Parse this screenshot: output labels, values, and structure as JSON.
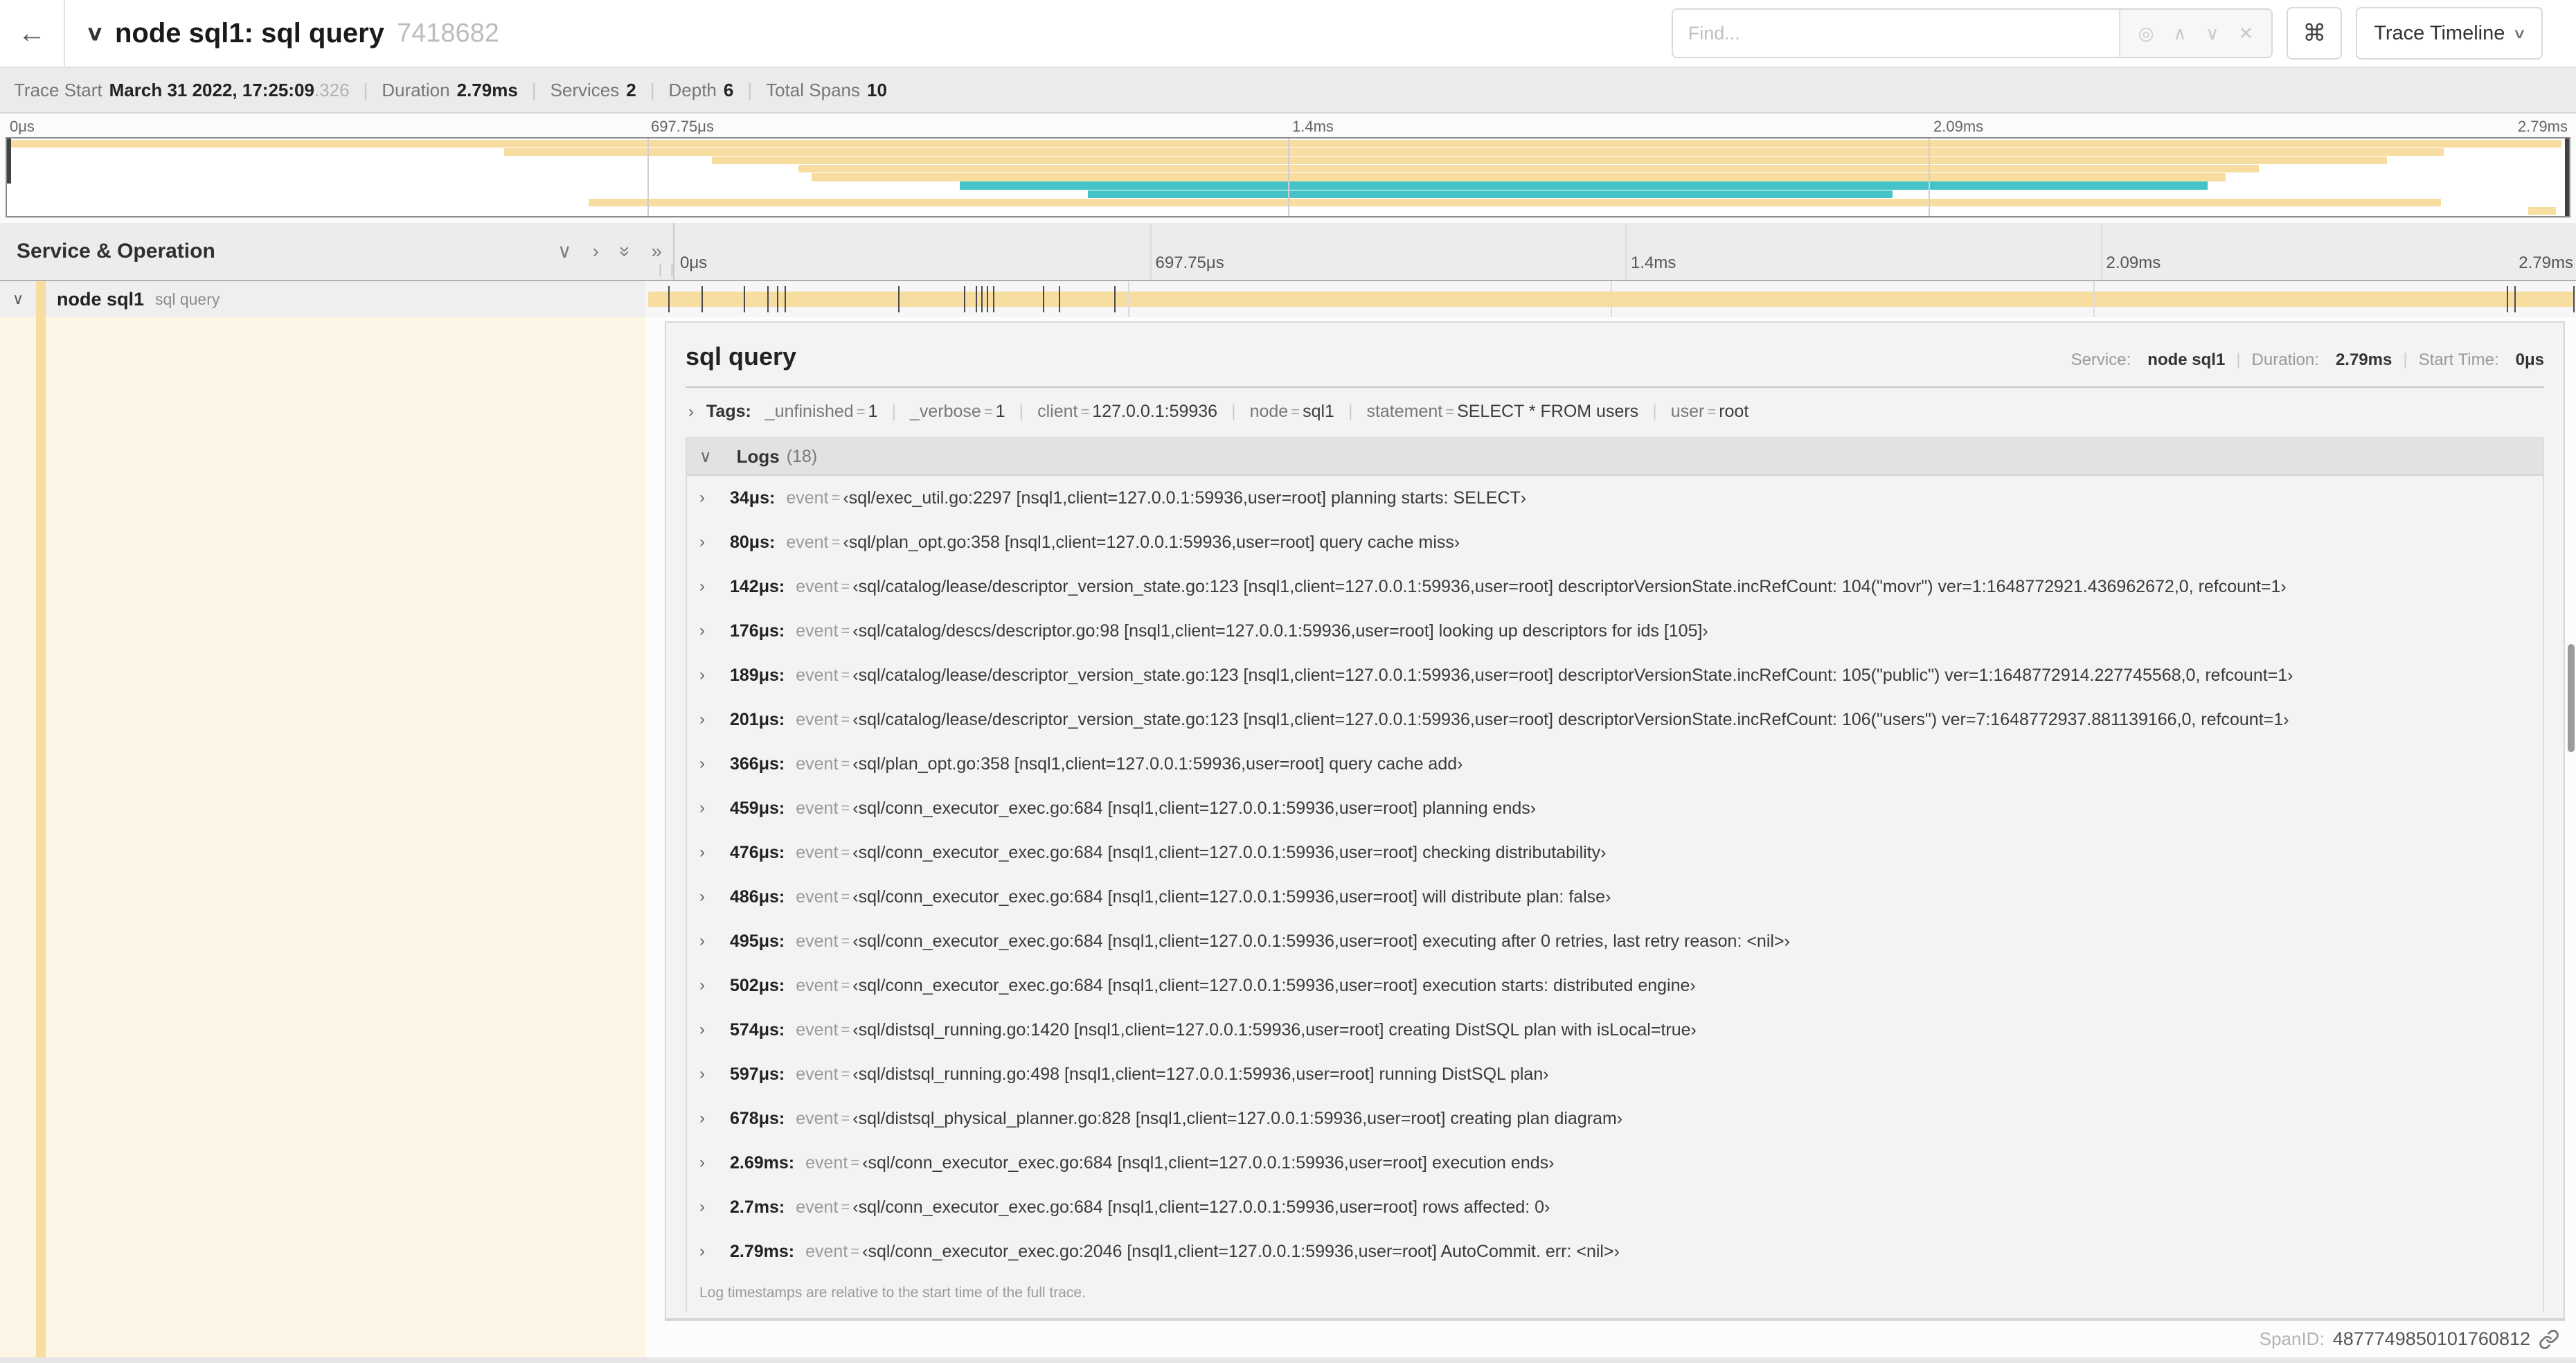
{
  "header": {
    "back_icon": "←",
    "title": "node sql1: sql query",
    "trace_id": "7418682",
    "find_placeholder": "Find...",
    "kbd_icon": "⌘",
    "view_select": "Trace Timeline"
  },
  "trace_info": {
    "items": [
      {
        "label": "Trace Start",
        "value": "March 31 2022, 17:25:09",
        "suffix": ".326"
      },
      {
        "label": "Duration",
        "value": "2.79ms"
      },
      {
        "label": "Services",
        "value": "2"
      },
      {
        "label": "Depth",
        "value": "6"
      },
      {
        "label": "Total Spans",
        "value": "10"
      }
    ]
  },
  "timeline": {
    "column_header": "Service & Operation",
    "ticks": [
      "0μs",
      "697.75μs",
      "1.4ms",
      "2.09ms",
      "2.79ms"
    ]
  },
  "minimap": {
    "spans": [
      {
        "start": 0,
        "end": 99.7,
        "color": "tan"
      },
      {
        "start": 19.4,
        "end": 95.1,
        "color": "tan"
      },
      {
        "start": 27.5,
        "end": 92.9,
        "color": "tan"
      },
      {
        "start": 30.9,
        "end": 87.9,
        "color": "tan"
      },
      {
        "start": 31.4,
        "end": 86.6,
        "color": "tan"
      },
      {
        "start": 37.2,
        "end": 85.9,
        "color": "teal"
      },
      {
        "start": 42.2,
        "end": 73.6,
        "color": "teal"
      },
      {
        "start": 22.7,
        "end": 95.0,
        "color": "tan"
      },
      {
        "start": 98.4,
        "end": 99.5,
        "color": "tan"
      }
    ]
  },
  "span_row": {
    "service": "node sql1",
    "operation": "sql query",
    "log_marks_pct": [
      1.2,
      2.9,
      5.1,
      6.3,
      6.8,
      7.2,
      13.1,
      16.5,
      17.1,
      17.4,
      17.7,
      18.0,
      20.6,
      21.4,
      24.3,
      96.4,
      96.8,
      99.85
    ]
  },
  "detail": {
    "operation": "sql query",
    "meta": [
      {
        "label": "Service:",
        "value": "node sql1"
      },
      {
        "label": "Duration:",
        "value": "2.79ms"
      },
      {
        "label": "Start Time:",
        "value": "0μs"
      }
    ],
    "tags_label": "Tags:",
    "tags": [
      {
        "key": "_unfinished",
        "value": "1"
      },
      {
        "key": "_verbose",
        "value": "1"
      },
      {
        "key": "client",
        "value": "127.0.0.1:59936"
      },
      {
        "key": "node",
        "value": "sql1"
      },
      {
        "key": "statement",
        "value": "SELECT * FROM users"
      },
      {
        "key": "user",
        "value": "root"
      }
    ],
    "logs_label": "Logs",
    "logs_count": "(18)",
    "logs": [
      {
        "ts": "34μs:",
        "key": "event",
        "value": "‹sql/exec_util.go:2297 [nsql1,client=127.0.0.1:59936,user=root] planning starts: SELECT›"
      },
      {
        "ts": "80μs:",
        "key": "event",
        "value": "‹sql/plan_opt.go:358 [nsql1,client=127.0.0.1:59936,user=root] query cache miss›"
      },
      {
        "ts": "142μs:",
        "key": "event",
        "value": "‹sql/catalog/lease/descriptor_version_state.go:123 [nsql1,client=127.0.0.1:59936,user=root] descriptorVersionState.incRefCount: 104(\"movr\") ver=1:1648772921.436962672,0, refcount=1›"
      },
      {
        "ts": "176μs:",
        "key": "event",
        "value": "‹sql/catalog/descs/descriptor.go:98 [nsql1,client=127.0.0.1:59936,user=root] looking up descriptors for ids [105]›"
      },
      {
        "ts": "189μs:",
        "key": "event",
        "value": "‹sql/catalog/lease/descriptor_version_state.go:123 [nsql1,client=127.0.0.1:59936,user=root] descriptorVersionState.incRefCount: 105(\"public\") ver=1:1648772914.227745568,0, refcount=1›"
      },
      {
        "ts": "201μs:",
        "key": "event",
        "value": "‹sql/catalog/lease/descriptor_version_state.go:123 [nsql1,client=127.0.0.1:59936,user=root] descriptorVersionState.incRefCount: 106(\"users\") ver=7:1648772937.881139166,0, refcount=1›"
      },
      {
        "ts": "366μs:",
        "key": "event",
        "value": "‹sql/plan_opt.go:358 [nsql1,client=127.0.0.1:59936,user=root] query cache add›"
      },
      {
        "ts": "459μs:",
        "key": "event",
        "value": "‹sql/conn_executor_exec.go:684 [nsql1,client=127.0.0.1:59936,user=root] planning ends›"
      },
      {
        "ts": "476μs:",
        "key": "event",
        "value": "‹sql/conn_executor_exec.go:684 [nsql1,client=127.0.0.1:59936,user=root] checking distributability›"
      },
      {
        "ts": "486μs:",
        "key": "event",
        "value": "‹sql/conn_executor_exec.go:684 [nsql1,client=127.0.0.1:59936,user=root] will distribute plan: false›"
      },
      {
        "ts": "495μs:",
        "key": "event",
        "value": "‹sql/conn_executor_exec.go:684 [nsql1,client=127.0.0.1:59936,user=root] executing after 0 retries, last retry reason: <nil>›"
      },
      {
        "ts": "502μs:",
        "key": "event",
        "value": "‹sql/conn_executor_exec.go:684 [nsql1,client=127.0.0.1:59936,user=root] execution starts: distributed engine›"
      },
      {
        "ts": "574μs:",
        "key": "event",
        "value": "‹sql/distsql_running.go:1420 [nsql1,client=127.0.0.1:59936,user=root] creating DistSQL plan with isLocal=true›"
      },
      {
        "ts": "597μs:",
        "key": "event",
        "value": "‹sql/distsql_running.go:498 [nsql1,client=127.0.0.1:59936,user=root] running DistSQL plan›"
      },
      {
        "ts": "678μs:",
        "key": "event",
        "value": "‹sql/distsql_physical_planner.go:828 [nsql1,client=127.0.0.1:59936,user=root] creating plan diagram›"
      },
      {
        "ts": "2.69ms:",
        "key": "event",
        "value": "‹sql/conn_executor_exec.go:684 [nsql1,client=127.0.0.1:59936,user=root] execution ends›"
      },
      {
        "ts": "2.7ms:",
        "key": "event",
        "value": "‹sql/conn_executor_exec.go:684 [nsql1,client=127.0.0.1:59936,user=root] rows affected: 0›"
      },
      {
        "ts": "2.79ms:",
        "key": "event",
        "value": "‹sql/conn_executor_exec.go:2046 [nsql1,client=127.0.0.1:59936,user=root] AutoCommit. err: <nil>›"
      }
    ],
    "logs_note": "Log timestamps are relative to the start time of the full trace.",
    "span_id_label": "SpanID:",
    "span_id": "4877749850101760812"
  },
  "colors": {
    "span_tan": "#F8DDA0",
    "span_teal": "#45C3C9",
    "detail_tint": "#FDF6E7"
  }
}
